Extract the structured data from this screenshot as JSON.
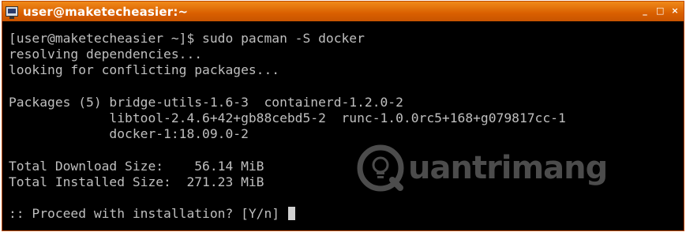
{
  "window": {
    "title": "user@maketecheasier:~",
    "minimize_label": "_",
    "maximize_label": "□",
    "close_label": "×",
    "title_icon": "terminal-icon",
    "titlebar_color": "#e06a00"
  },
  "terminal": {
    "lines": [
      "[user@maketecheasier ~]$ sudo pacman -S docker",
      "resolving dependencies...",
      "looking for conflicting packages...",
      "",
      "Packages (5) bridge-utils-1.6-3  containerd-1.2.0-2",
      "             libtool-2.4.6+42+gb88cebd5-2  runc-1.0.0rc5+168+g079817cc-1",
      "             docker-1:18.09.0-2",
      "",
      "Total Download Size:    56.14 MiB",
      "Total Installed Size:  271.23 MiB",
      "",
      ":: Proceed with installation? [Y/n] "
    ]
  },
  "watermark": {
    "text": "uantrimang",
    "logo_icon": "lightbulb-q-logo"
  }
}
